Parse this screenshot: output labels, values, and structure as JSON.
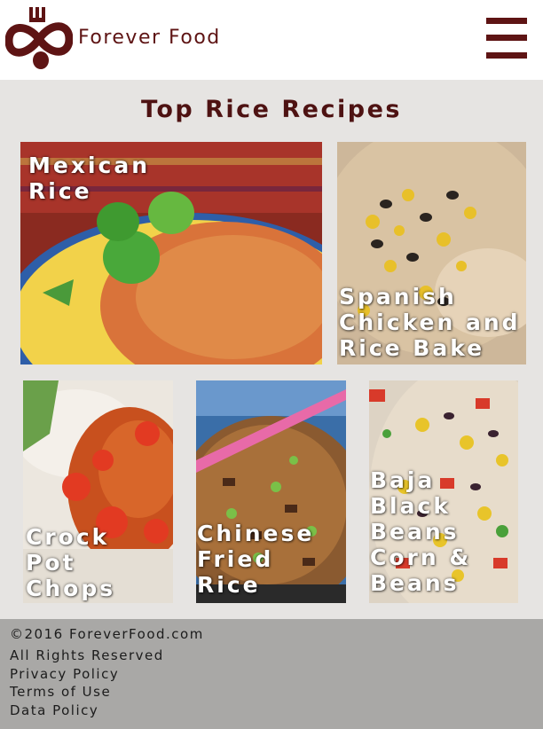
{
  "header": {
    "brand": "Forever Food",
    "logo_icon": "fork-spoon-infinity-icon",
    "menu_icon": "hamburger-menu-icon",
    "brand_color": "#5e1414"
  },
  "page_title": "Top Rice Recipes",
  "recipes": [
    {
      "title": "Mexican\nRice"
    },
    {
      "title": "Spanish\nChicken and\nRice Bake"
    },
    {
      "title": "Crock\nPot\nChops"
    },
    {
      "title": "Chinese\nFried\nRice"
    },
    {
      "title": "Baja\nBlack\nBeans\nCorn &\nBeans"
    }
  ],
  "footer": {
    "copyright": "©2016 ForeverFood.com",
    "rights": "All Rights Reserved",
    "privacy": "Privacy Policy",
    "terms": "Terms of Use",
    "data_policy": "Data Policy"
  }
}
